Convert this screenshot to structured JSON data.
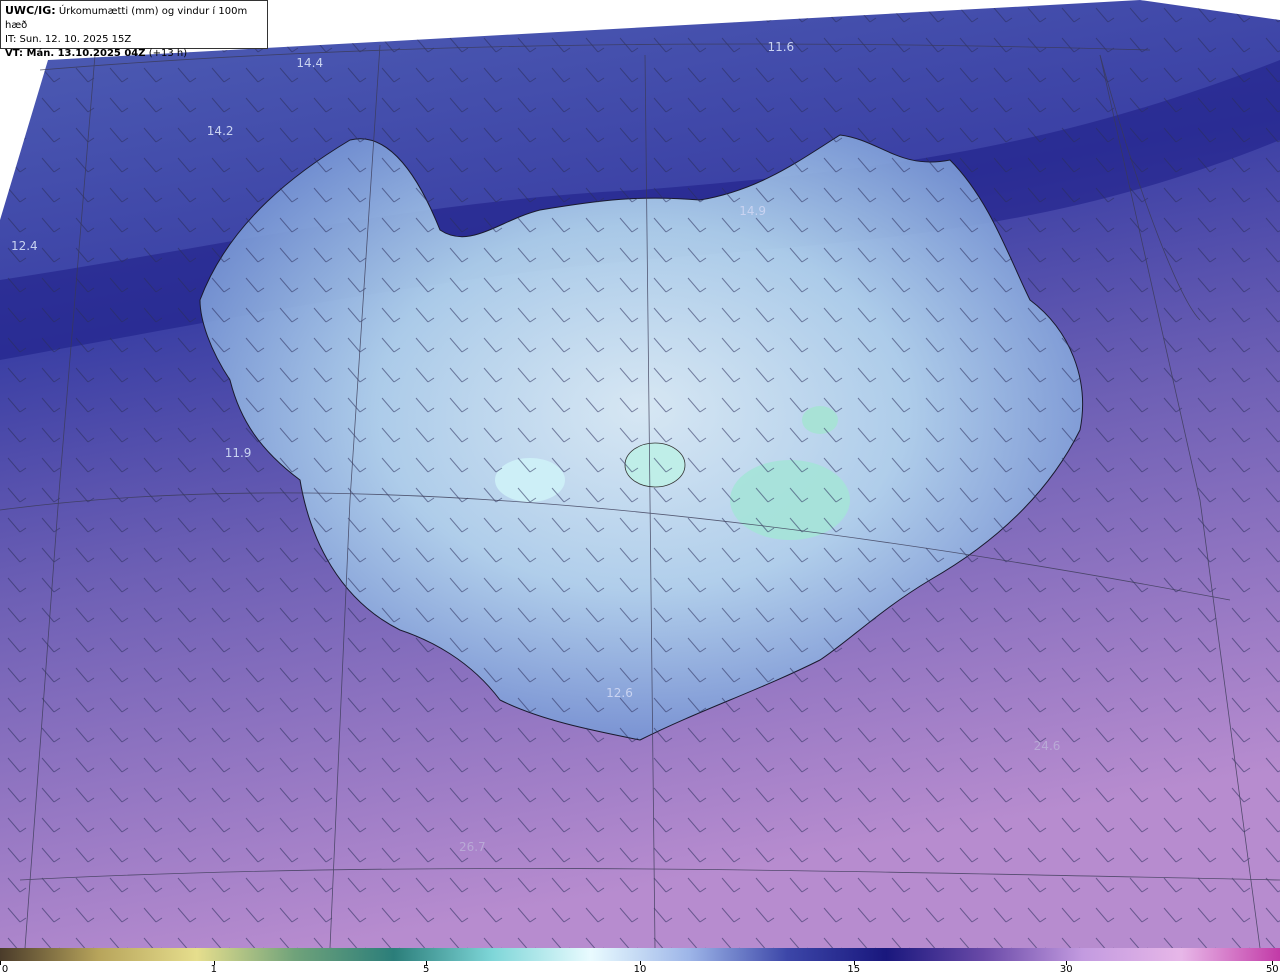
{
  "header": {
    "title_bold": "UWC/IG:",
    "title_rest": " Úrkomumætti (mm) og vindur í 100m hæð",
    "issue_time": "IT: Sun. 12. 10. 2025 15Z",
    "valid_bold": "VT: Mán. 13.10.2025 04Z",
    "valid_rest": " (+13 h)"
  },
  "map_labels": [
    {
      "text": "14.4",
      "x_pct": 24.2,
      "y_pct": 6.6,
      "tone": "light"
    },
    {
      "text": "11.6",
      "x_pct": 61.0,
      "y_pct": 5.0,
      "tone": "light"
    },
    {
      "text": "14.2",
      "x_pct": 17.2,
      "y_pct": 13.8,
      "tone": "light"
    },
    {
      "text": "12.4",
      "x_pct": 1.9,
      "y_pct": 26.0,
      "tone": "light"
    },
    {
      "text": "14.9",
      "x_pct": 58.8,
      "y_pct": 22.3,
      "tone": "light"
    },
    {
      "text": "11.9",
      "x_pct": 18.6,
      "y_pct": 47.8,
      "tone": "light"
    },
    {
      "text": "12.6",
      "x_pct": 48.4,
      "y_pct": 73.1,
      "tone": "light"
    },
    {
      "text": "24.6",
      "x_pct": 81.8,
      "y_pct": 78.7,
      "tone": "dark"
    },
    {
      "text": "26.7",
      "x_pct": 36.9,
      "y_pct": 89.3,
      "tone": "dark"
    }
  ],
  "colors": {
    "ocean_north": "#4b5ab0",
    "ocean_south": "#9b71bf",
    "land_light": "#c7ecf5",
    "land_mid": "#7e9fd8",
    "deep_band": "#1b1b86"
  },
  "colorbar": {
    "ticks": [
      {
        "label": "0",
        "pos": 0
      },
      {
        "label": "1",
        "pos": 16.7
      },
      {
        "label": "5",
        "pos": 33.3
      },
      {
        "label": "10",
        "pos": 50
      },
      {
        "label": "15",
        "pos": 66.7
      },
      {
        "label": "30",
        "pos": 83.3
      },
      {
        "label": "50",
        "pos": 99.4
      }
    ],
    "gradient_stops": [
      "#4a3b2a",
      "#b7a45b",
      "#e6de8d",
      "#6fa27a",
      "#2b7e7a",
      "#7ed6d8",
      "#e9fbff",
      "#9db5e8",
      "#3c46a8",
      "#19177d",
      "#6a4aa8",
      "#c39be0",
      "#e7b7e8",
      "#c23aa7"
    ]
  }
}
